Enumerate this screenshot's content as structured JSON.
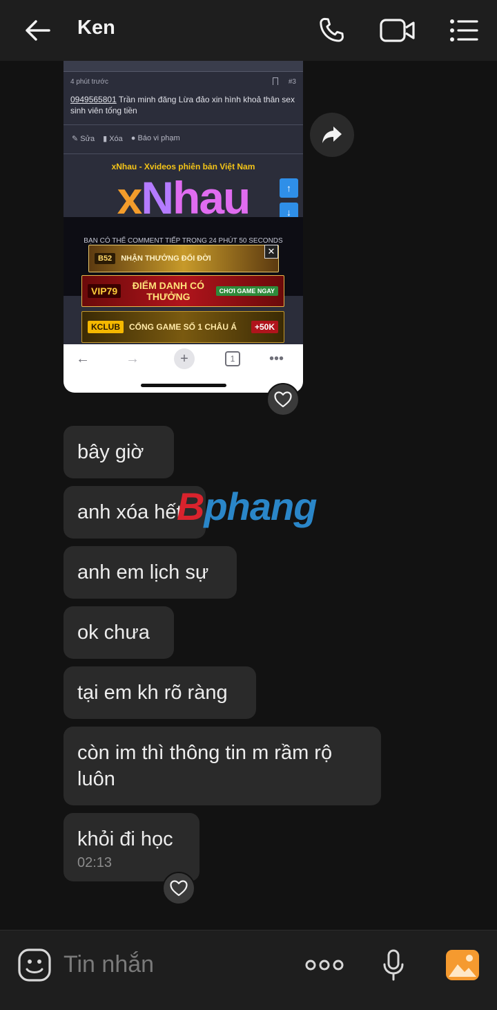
{
  "header": {
    "contact_name": "Ken",
    "icons": [
      "back-arrow-icon",
      "phone-icon",
      "video-camera-icon",
      "menu-list-icon"
    ]
  },
  "shared_screenshot": {
    "post_time": "4 phút trước",
    "post_number": "#3",
    "post_phone": "0949565801",
    "post_text": " Trần minh đăng Lừa đảo xin hình khoả thân sex sinh viên tống tiền",
    "actions": {
      "edit": "Sửa",
      "delete": "Xóa",
      "report": "Báo vi phạm"
    },
    "site_title": "xNhau - Xvideos phiên bản Việt Nam",
    "logo": {
      "x": "x",
      "n": "N",
      "rest": "hau"
    },
    "countdown": "BẠN CÓ THỂ COMMENT TIẾP TRONG 24 PHÚT 50 SECONDS",
    "ad1_brand": "B52",
    "ad1_text": "NHẬN THƯỞNG ĐỔI ĐỜI",
    "ad2_brand": "VIP79",
    "ad2_text": "ĐIỂM DANH CÓ THƯỞNG",
    "ad2_cta": "CHƠI GAME NGAY",
    "ad3_brand": "KCLUB",
    "ad3_text": "CỔNG GAME SỐ 1 CHÂU Á",
    "ad3_bonus": "+50K",
    "tab_count": "1"
  },
  "messages": [
    {
      "text": "bây giờ"
    },
    {
      "text": "anh xóa hết"
    },
    {
      "text": "anh em lịch sự"
    },
    {
      "text": "ok chưa"
    },
    {
      "text": "tại em kh rõ ràng"
    },
    {
      "text": "còn im thì thông tin m rầm rộ luôn"
    },
    {
      "text": "khỏi đi học",
      "time": "02:13"
    }
  ],
  "watermark": {
    "first": "B",
    "rest": "phang"
  },
  "composer": {
    "placeholder": "Tin nhắn",
    "icons": [
      "sticker-icon",
      "more-icon",
      "microphone-icon",
      "image-icon"
    ]
  }
}
